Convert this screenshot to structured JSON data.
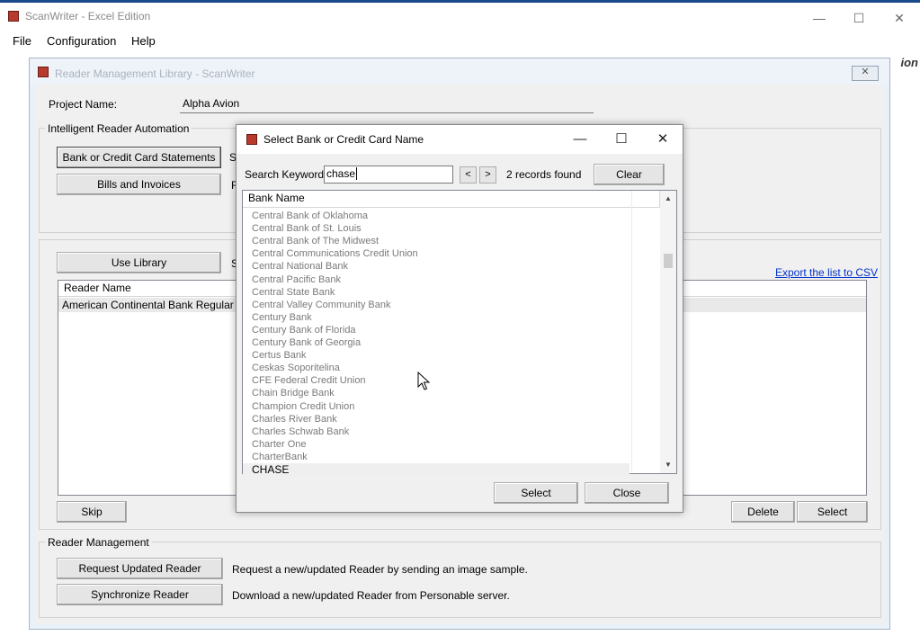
{
  "app": {
    "title": "ScanWriter - Excel Edition",
    "window_controls": {
      "minimize": "—",
      "maximize": "☐",
      "close": "✕"
    },
    "menu": [
      "File",
      "Configuration",
      "Help"
    ],
    "corner_text": "ion"
  },
  "library_window": {
    "title": "Reader Management Library - ScanWriter",
    "close_glyph": "✕",
    "project_name_label": "Project Name:",
    "project_name_value": "Alpha Avion",
    "automation_group_title": "Intelligent Reader Automation",
    "bank_button": "Bank or Credit Card Statements",
    "bank_button_suffix": "S",
    "bills_button": "Bills and Invoices",
    "bills_button_suffix": "F",
    "use_library_button": "Use Library",
    "use_library_suffix": "S",
    "export_link": "Export the list to CSV",
    "reader_list": {
      "header": "Reader Name",
      "rows": [
        "American Continental Bank Regular Busi"
      ]
    },
    "skip_button": "Skip",
    "delete_button": "Delete",
    "select_button": "Select",
    "management_group_title": "Reader Management",
    "request_button": "Request Updated Reader",
    "request_desc": "Request a new/updated Reader by sending an image sample.",
    "sync_button": "Synchronize Reader",
    "sync_desc": "Download a new/updated Reader from Personable server."
  },
  "dialog": {
    "title": "Select Bank or Credit Card Name",
    "controls": {
      "minimize": "—",
      "maximize": "☐",
      "close": "✕"
    },
    "search_label": "Search Keyword",
    "search_value": "chase",
    "prev_glyph": "<",
    "next_glyph": ">",
    "records_found": "2 records found",
    "clear_button": "Clear",
    "column_header": "Bank Name",
    "scroll_up": "▲",
    "scroll_down": "▼",
    "banks": [
      "Central Bank of Oklahoma",
      "Central Bank of St. Louis",
      "Central Bank of The Midwest",
      "Central Communications Credit Union",
      "Central National Bank",
      "Central Pacific Bank",
      "Central State Bank",
      "Central Valley Community Bank",
      "Century Bank",
      "Century Bank of Florida",
      "Century Bank of Georgia",
      "Certus Bank",
      "Ceskas Soporitelina",
      "CFE Federal Credit Union",
      "Chain Bridge Bank",
      "Champion Credit Union",
      "Charles River Bank",
      "Charles Schwab Bank",
      "Charter One",
      "CharterBank",
      "CHASE"
    ],
    "selected_bank": "CHASE",
    "select_button": "Select",
    "close_button": "Close"
  }
}
